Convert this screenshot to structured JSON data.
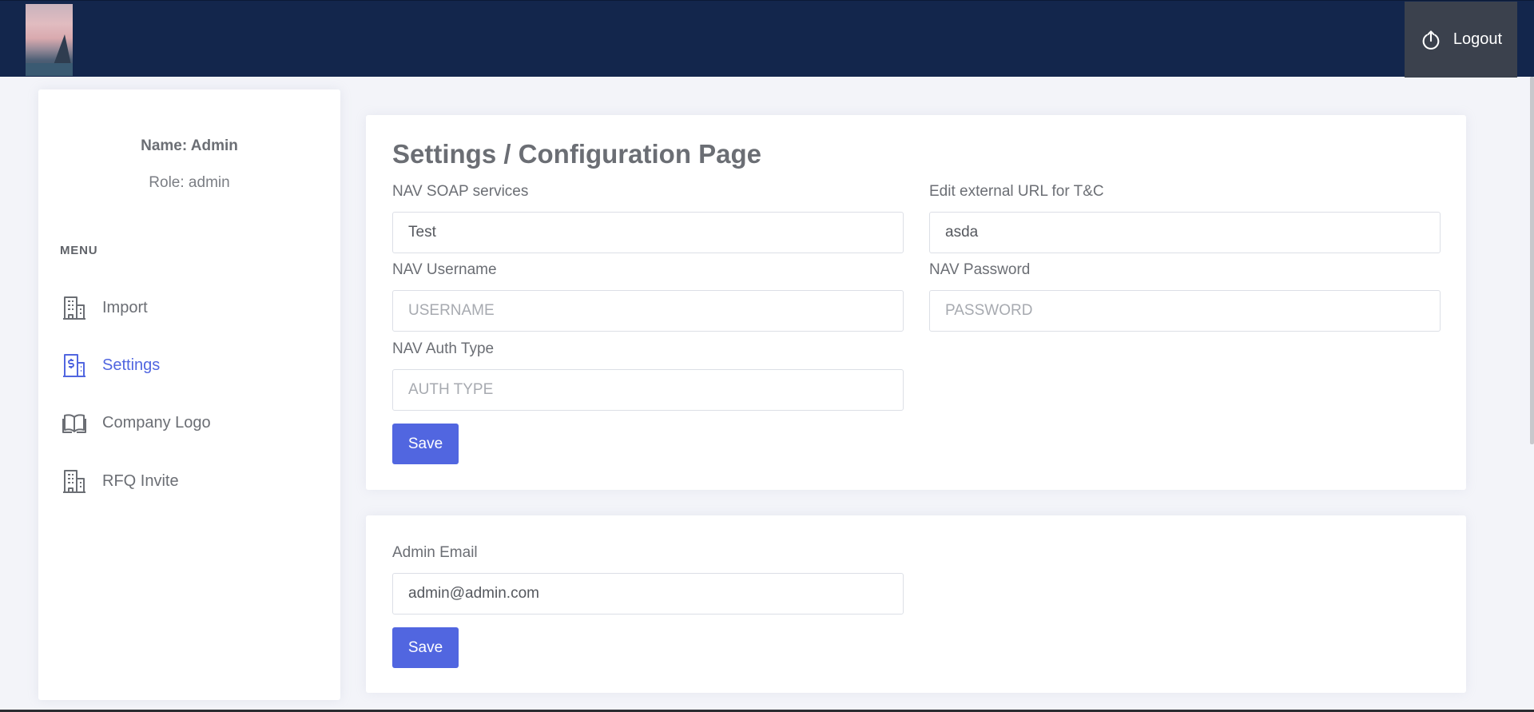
{
  "header": {
    "logout_label": "Logout"
  },
  "sidebar": {
    "name": "Name: Admin",
    "role": "Role: admin",
    "menu_title": "MENU",
    "items": [
      {
        "label": "Import",
        "icon": "building-icon",
        "active": false
      },
      {
        "label": "Settings",
        "icon": "receipt-dollar-icon",
        "active": true
      },
      {
        "label": "Company Logo",
        "icon": "book-open-icon",
        "active": false
      },
      {
        "label": "RFQ Invite",
        "icon": "building-icon",
        "active": false
      }
    ]
  },
  "settings": {
    "title": "Settings / Configuration Page",
    "soap": {
      "label": "NAV SOAP services",
      "value": "Test"
    },
    "tc_url": {
      "label": "Edit external URL for T&C",
      "value": "asda"
    },
    "username": {
      "label": "NAV Username",
      "value": "",
      "placeholder": "USERNAME"
    },
    "password": {
      "label": "NAV Password",
      "value": "",
      "placeholder": "PASSWORD"
    },
    "auth_type": {
      "label": "NAV Auth Type",
      "value": "",
      "placeholder": "AUTH TYPE"
    },
    "save_label": "Save"
  },
  "email": {
    "label": "Admin Email",
    "value": "admin@admin.com",
    "save_label": "Save"
  },
  "colors": {
    "header": "#13264c",
    "accent": "#5166e0",
    "logout_bg": "#3b414d",
    "page_bg": "#f3f4f9"
  }
}
